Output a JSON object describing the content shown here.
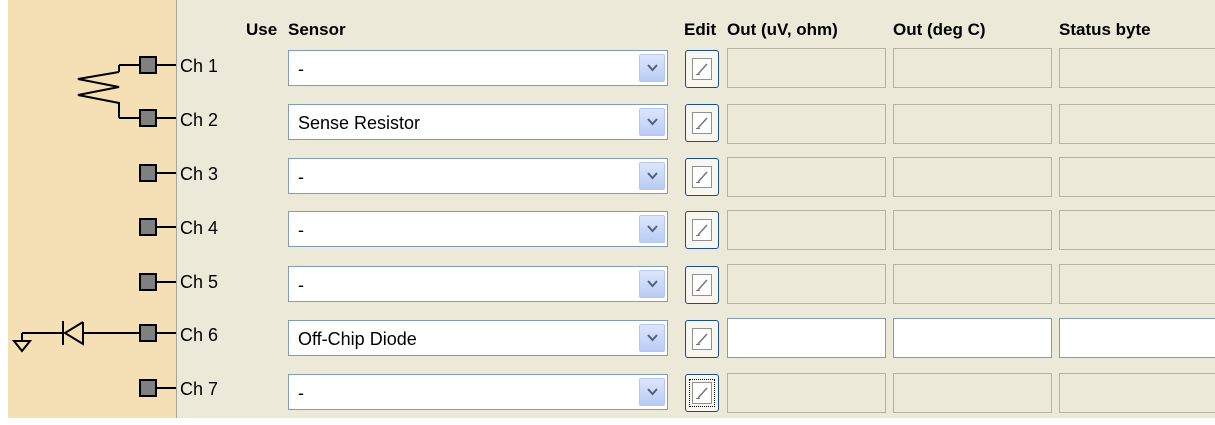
{
  "headers": {
    "use": "Use",
    "sensor": "Sensor",
    "edit": "Edit",
    "out_uv_ohm": "Out (uV, ohm)",
    "out_deg_c": "Out (deg C)",
    "status_byte": "Status byte"
  },
  "channels": [
    {
      "label": "Ch 1",
      "sensor": "-"
    },
    {
      "label": "Ch 2",
      "sensor": "Sense Resistor"
    },
    {
      "label": "Ch 3",
      "sensor": "-"
    },
    {
      "label": "Ch 4",
      "sensor": "-"
    },
    {
      "label": "Ch 5",
      "sensor": "-"
    },
    {
      "label": "Ch 6",
      "sensor": "Off-Chip Diode"
    },
    {
      "label": "Ch 7",
      "sensor": "-"
    }
  ],
  "outputs": [
    {
      "uv_ohm": "",
      "deg_c": "",
      "status": ""
    },
    {
      "uv_ohm": "",
      "deg_c": "",
      "status": ""
    },
    {
      "uv_ohm": "",
      "deg_c": "",
      "status": ""
    },
    {
      "uv_ohm": "",
      "deg_c": "",
      "status": ""
    },
    {
      "uv_ohm": "",
      "deg_c": "",
      "status": ""
    },
    {
      "uv_ohm": "",
      "deg_c": "",
      "status": ""
    },
    {
      "uv_ohm": "",
      "deg_c": "",
      "status": ""
    }
  ],
  "icons": {
    "dropdown": "chevron-down-icon",
    "edit": "edit-pencil-icon",
    "resistor": "resistor-symbol",
    "diode": "diode-symbol",
    "ground": "ground-symbol",
    "terminal": "channel-terminal"
  },
  "colors": {
    "schematic_bg": "#f5dfb4",
    "panel_bg": "#ece9d8",
    "field_border": "#7f9db9",
    "button_border": "#1c4d8c"
  }
}
